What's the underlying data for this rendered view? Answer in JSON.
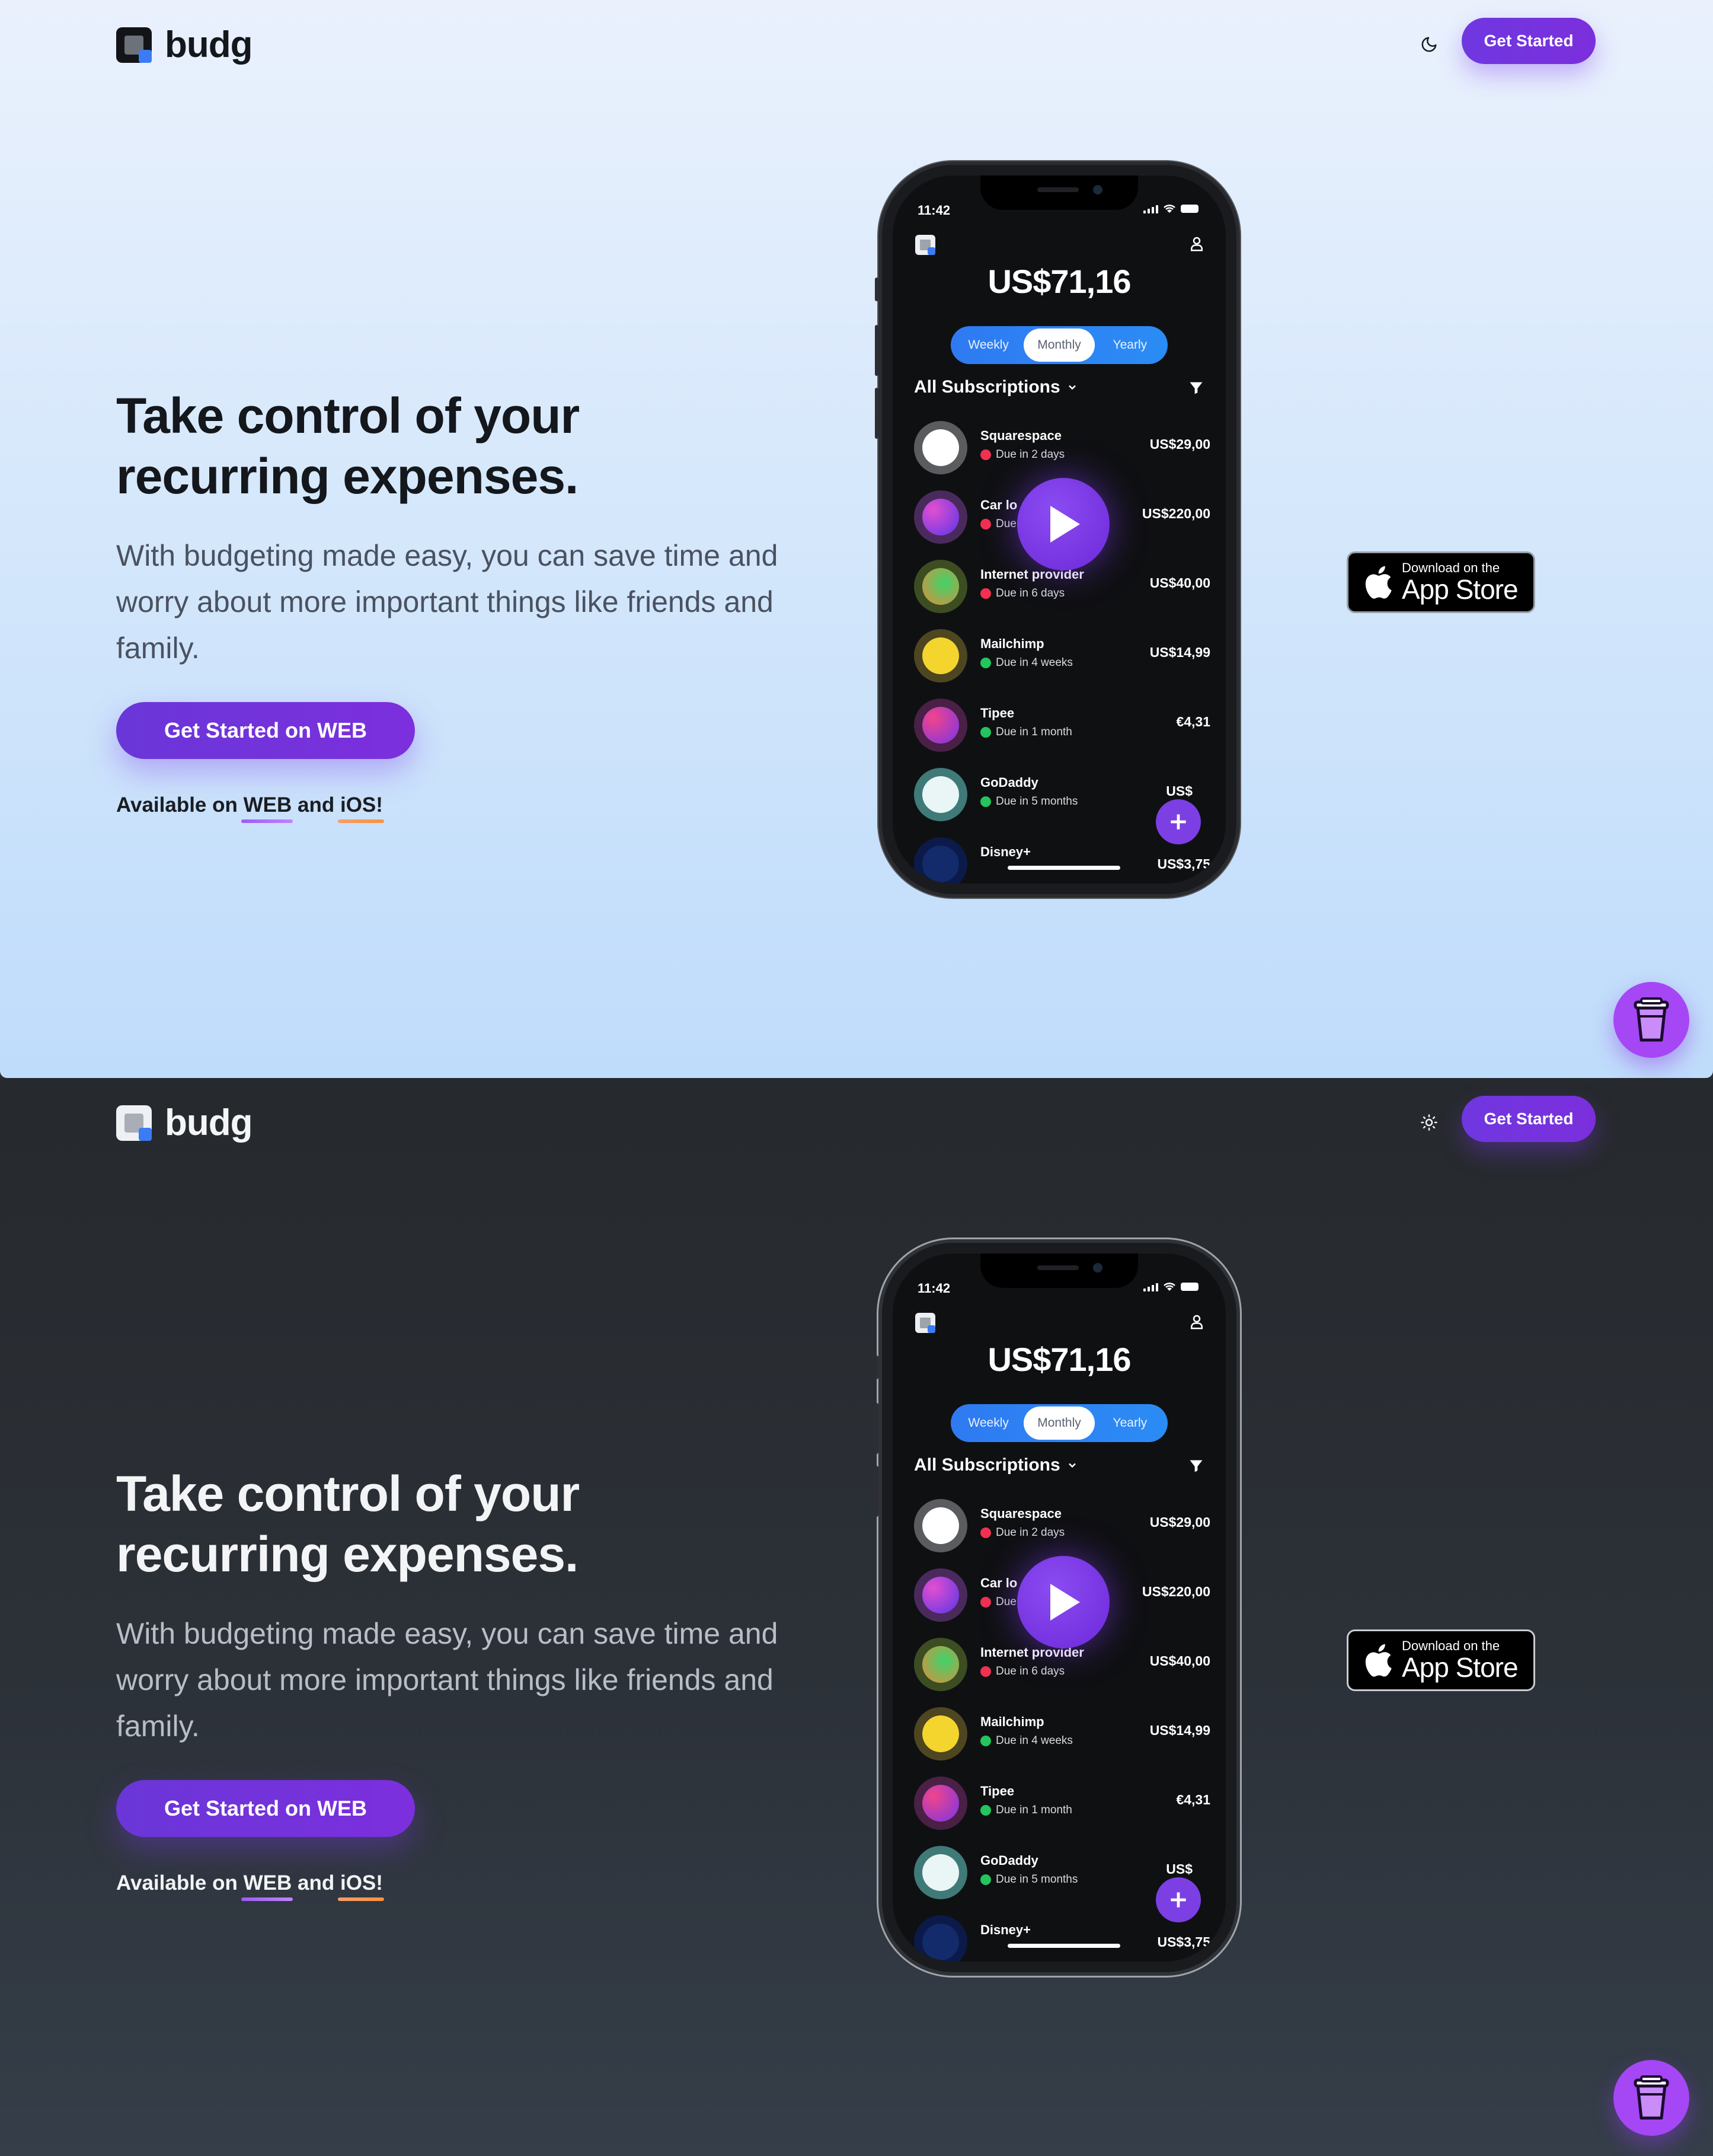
{
  "brand": {
    "name": "budg"
  },
  "nav": {
    "cta": "Get Started",
    "theme_toggle_light": "moon-icon",
    "theme_toggle_dark": "sun-icon"
  },
  "hero": {
    "headline_line1": "Take control of your",
    "headline_line2": "recurring expenses.",
    "subtitle": "With budgeting made easy, you can save time and worry about more important things like friends and family.",
    "cta": "Get Started on WEB",
    "available_prefix": "Available on",
    "available_web": "WEB",
    "available_and": "and",
    "available_ios": "iOS!"
  },
  "appstore": {
    "small": "Download on the",
    "big": "App Store"
  },
  "phone": {
    "time": "11:42",
    "total": "US$71,16",
    "periods": [
      "Weekly",
      "Monthly",
      "Yearly"
    ],
    "selected_period": "Monthly",
    "list_title": "All Subscriptions",
    "subscriptions": [
      {
        "name": "Squarespace",
        "due": "Due in 2 days",
        "price": "US$29,00",
        "status": "red"
      },
      {
        "name": "Car lo",
        "due": "Due",
        "price": "US$220,00",
        "status": "red"
      },
      {
        "name": "Internet provider",
        "due": "Due in 6 days",
        "price": "US$40,00",
        "status": "red"
      },
      {
        "name": "Mailchimp",
        "due": "Due in 4 weeks",
        "price": "US$14,99",
        "status": "green"
      },
      {
        "name": "Tipee",
        "due": "Due in 1 month",
        "price": "€4,31",
        "status": "green"
      },
      {
        "name": "GoDaddy",
        "due": "Due in 5 months",
        "price": "US$",
        "status": "green"
      },
      {
        "name": "Disney+",
        "due": "",
        "price": "US$3,75",
        "status": "green"
      }
    ]
  },
  "colors": {
    "accent": "#7c3aed",
    "status_red": "#f0314f",
    "status_green": "#22c55e",
    "segment_blue": "#2f7af2"
  }
}
